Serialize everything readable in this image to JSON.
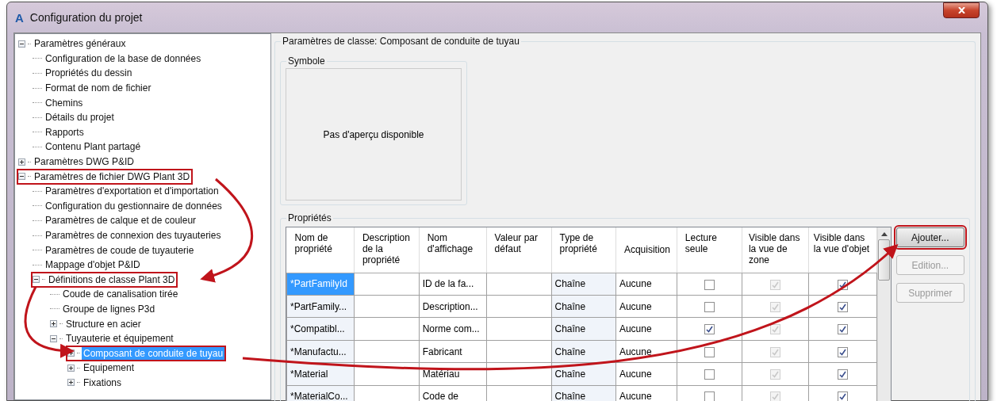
{
  "window": {
    "icon_letter": "A",
    "title": "Configuration du projet"
  },
  "tree": [
    {
      "label": "Paramètres généraux",
      "expanded": true,
      "selected": false,
      "highlighted": false,
      "children": [
        {
          "label": "Configuration de la base de données",
          "selected": false,
          "highlighted": false
        },
        {
          "label": "Propriétés du dessin",
          "selected": false,
          "highlighted": false
        },
        {
          "label": "Format de nom de fichier",
          "selected": false,
          "highlighted": false
        },
        {
          "label": "Chemins",
          "selected": false,
          "highlighted": false
        },
        {
          "label": "Détails du projet",
          "selected": false,
          "highlighted": false
        },
        {
          "label": "Rapports",
          "selected": false,
          "highlighted": false
        },
        {
          "label": "Contenu Plant partagé",
          "selected": false,
          "highlighted": false
        }
      ]
    },
    {
      "label": "Paramètres DWG P&ID",
      "expanded": false,
      "selected": false,
      "highlighted": false
    },
    {
      "label": "Paramètres de fichier DWG Plant 3D",
      "expanded": true,
      "selected": false,
      "highlighted": true,
      "children": [
        {
          "label": "Paramètres d'exportation et d'importation",
          "selected": false,
          "highlighted": false
        },
        {
          "label": "Configuration du gestionnaire de données",
          "selected": false,
          "highlighted": false
        },
        {
          "label": "Paramètres de calque et de couleur",
          "selected": false,
          "highlighted": false
        },
        {
          "label": "Paramètres de connexion des tuyauteries",
          "selected": false,
          "highlighted": false
        },
        {
          "label": "Paramètres de coude de tuyauterie",
          "selected": false,
          "highlighted": false
        },
        {
          "label": "Mappage d'objet P&ID",
          "selected": false,
          "highlighted": false
        },
        {
          "label": "Définitions de classe Plant 3D",
          "expanded": true,
          "selected": false,
          "highlighted": true,
          "children": [
            {
              "label": "Coude de canalisation tirée",
              "selected": false,
              "highlighted": false
            },
            {
              "label": "Groupe de lignes P3d",
              "selected": false,
              "highlighted": false
            },
            {
              "label": "Structure en acier",
              "expanded": false,
              "selected": false,
              "highlighted": false
            },
            {
              "label": "Tuyauterie et équipement",
              "expanded": true,
              "selected": false,
              "highlighted": false,
              "children": [
                {
                  "label": "Composant de conduite de tuyau",
                  "expanded": false,
                  "selected": true,
                  "highlighted": true
                },
                {
                  "label": "Equipement",
                  "expanded": false,
                  "selected": false,
                  "highlighted": false
                },
                {
                  "label": "Fixations",
                  "expanded": false,
                  "selected": false,
                  "highlighted": false
                }
              ]
            }
          ]
        }
      ]
    }
  ],
  "class_settings": {
    "title": "Paramètres de classe: Composant de conduite de tuyau",
    "symbol": {
      "title": "Symbole",
      "preview": "Pas d'aperçu disponible"
    },
    "properties": {
      "title": "Propriétés",
      "columns": [
        "Nom de propriété",
        "Description de la propriété",
        "Nom d'affichage",
        "Valeur par défaut",
        "Type de propriété",
        "Acquisition",
        "Lecture seule",
        "Visible dans la vue de zone",
        "Visible dans la vue d'objet"
      ],
      "rows": [
        {
          "selected": true,
          "name": "*PartFamilyId",
          "display_name": "ID de la fa...",
          "type": "Chaîne",
          "acquisition": "Aucune",
          "read_only": {
            "checked": false,
            "disabled": false
          },
          "visible_zone": {
            "checked": true,
            "disabled": true
          },
          "visible_object": {
            "checked": true,
            "disabled": false
          }
        },
        {
          "selected": false,
          "name": "*PartFamily...",
          "display_name": "Description...",
          "type": "Chaîne",
          "acquisition": "Aucune",
          "read_only": {
            "checked": false,
            "disabled": false
          },
          "visible_zone": {
            "checked": true,
            "disabled": true
          },
          "visible_object": {
            "checked": true,
            "disabled": false
          }
        },
        {
          "selected": false,
          "name": "*Compatibl...",
          "display_name": "Norme com...",
          "type": "Chaîne",
          "acquisition": "Aucune",
          "read_only": {
            "checked": true,
            "disabled": false
          },
          "visible_zone": {
            "checked": true,
            "disabled": true
          },
          "visible_object": {
            "checked": true,
            "disabled": false
          }
        },
        {
          "selected": false,
          "name": "*Manufactu...",
          "display_name": "Fabricant",
          "type": "Chaîne",
          "acquisition": "Aucune",
          "read_only": {
            "checked": false,
            "disabled": false
          },
          "visible_zone": {
            "checked": true,
            "disabled": true
          },
          "visible_object": {
            "checked": true,
            "disabled": false
          }
        },
        {
          "selected": false,
          "name": "*Material",
          "display_name": "Matériau",
          "type": "Chaîne",
          "acquisition": "Aucune",
          "read_only": {
            "checked": false,
            "disabled": false
          },
          "visible_zone": {
            "checked": true,
            "disabled": true
          },
          "visible_object": {
            "checked": true,
            "disabled": false
          }
        },
        {
          "selected": false,
          "name": "*MaterialCo...",
          "display_name": "Code de",
          "type": "Chaîne",
          "acquisition": "Aucune",
          "read_only": {
            "checked": false,
            "disabled": false
          },
          "visible_zone": {
            "checked": true,
            "disabled": true
          },
          "visible_object": {
            "checked": true,
            "disabled": false
          }
        }
      ]
    },
    "buttons": [
      {
        "label": "Ajouter...",
        "disabled": false,
        "highlighted": true
      },
      {
        "label": "Edition...",
        "disabled": true,
        "highlighted": false
      },
      {
        "label": "Supprimer",
        "disabled": true,
        "highlighted": false
      }
    ]
  }
}
